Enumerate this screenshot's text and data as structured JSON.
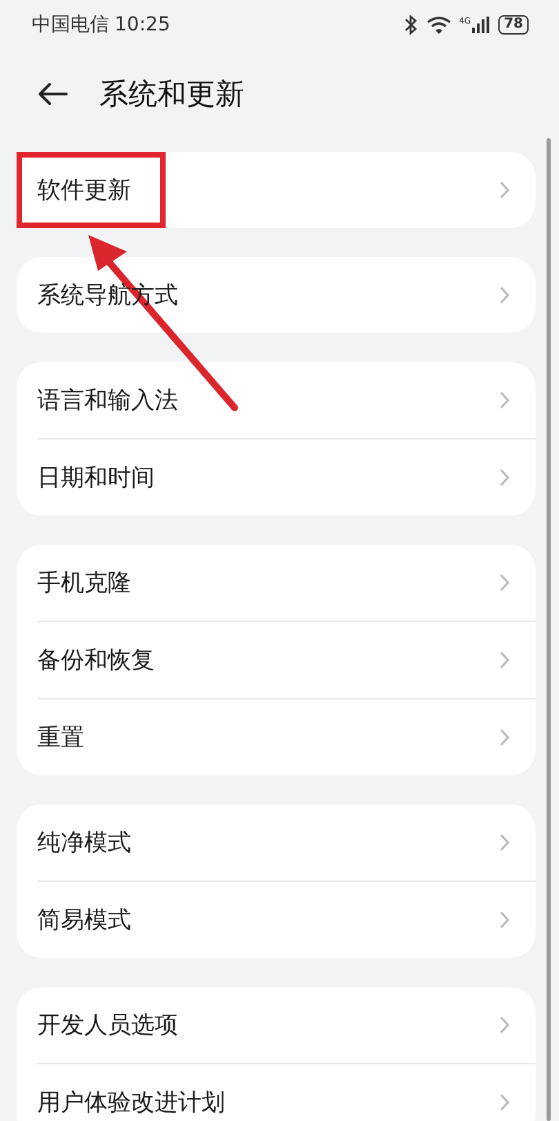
{
  "status_bar": {
    "carrier": "中国电信",
    "time": "10:25",
    "network": "4G",
    "battery": "78"
  },
  "header": {
    "title": "系统和更新"
  },
  "groups": [
    {
      "items": [
        {
          "label": "软件更新",
          "highlighted": true
        }
      ]
    },
    {
      "items": [
        {
          "label": "系统导航方式",
          "highlighted": false
        }
      ]
    },
    {
      "items": [
        {
          "label": "语言和输入法",
          "highlighted": false
        },
        {
          "label": "日期和时间",
          "highlighted": false
        }
      ]
    },
    {
      "items": [
        {
          "label": "手机克隆",
          "highlighted": false
        },
        {
          "label": "备份和恢复",
          "highlighted": false
        },
        {
          "label": "重置",
          "highlighted": false
        }
      ]
    },
    {
      "items": [
        {
          "label": "纯净模式",
          "highlighted": false
        },
        {
          "label": "简易模式",
          "highlighted": false
        }
      ]
    },
    {
      "items": [
        {
          "label": "开发人员选项",
          "highlighted": false
        },
        {
          "label": "用户体验改进计划",
          "highlighted": false
        }
      ]
    }
  ]
}
